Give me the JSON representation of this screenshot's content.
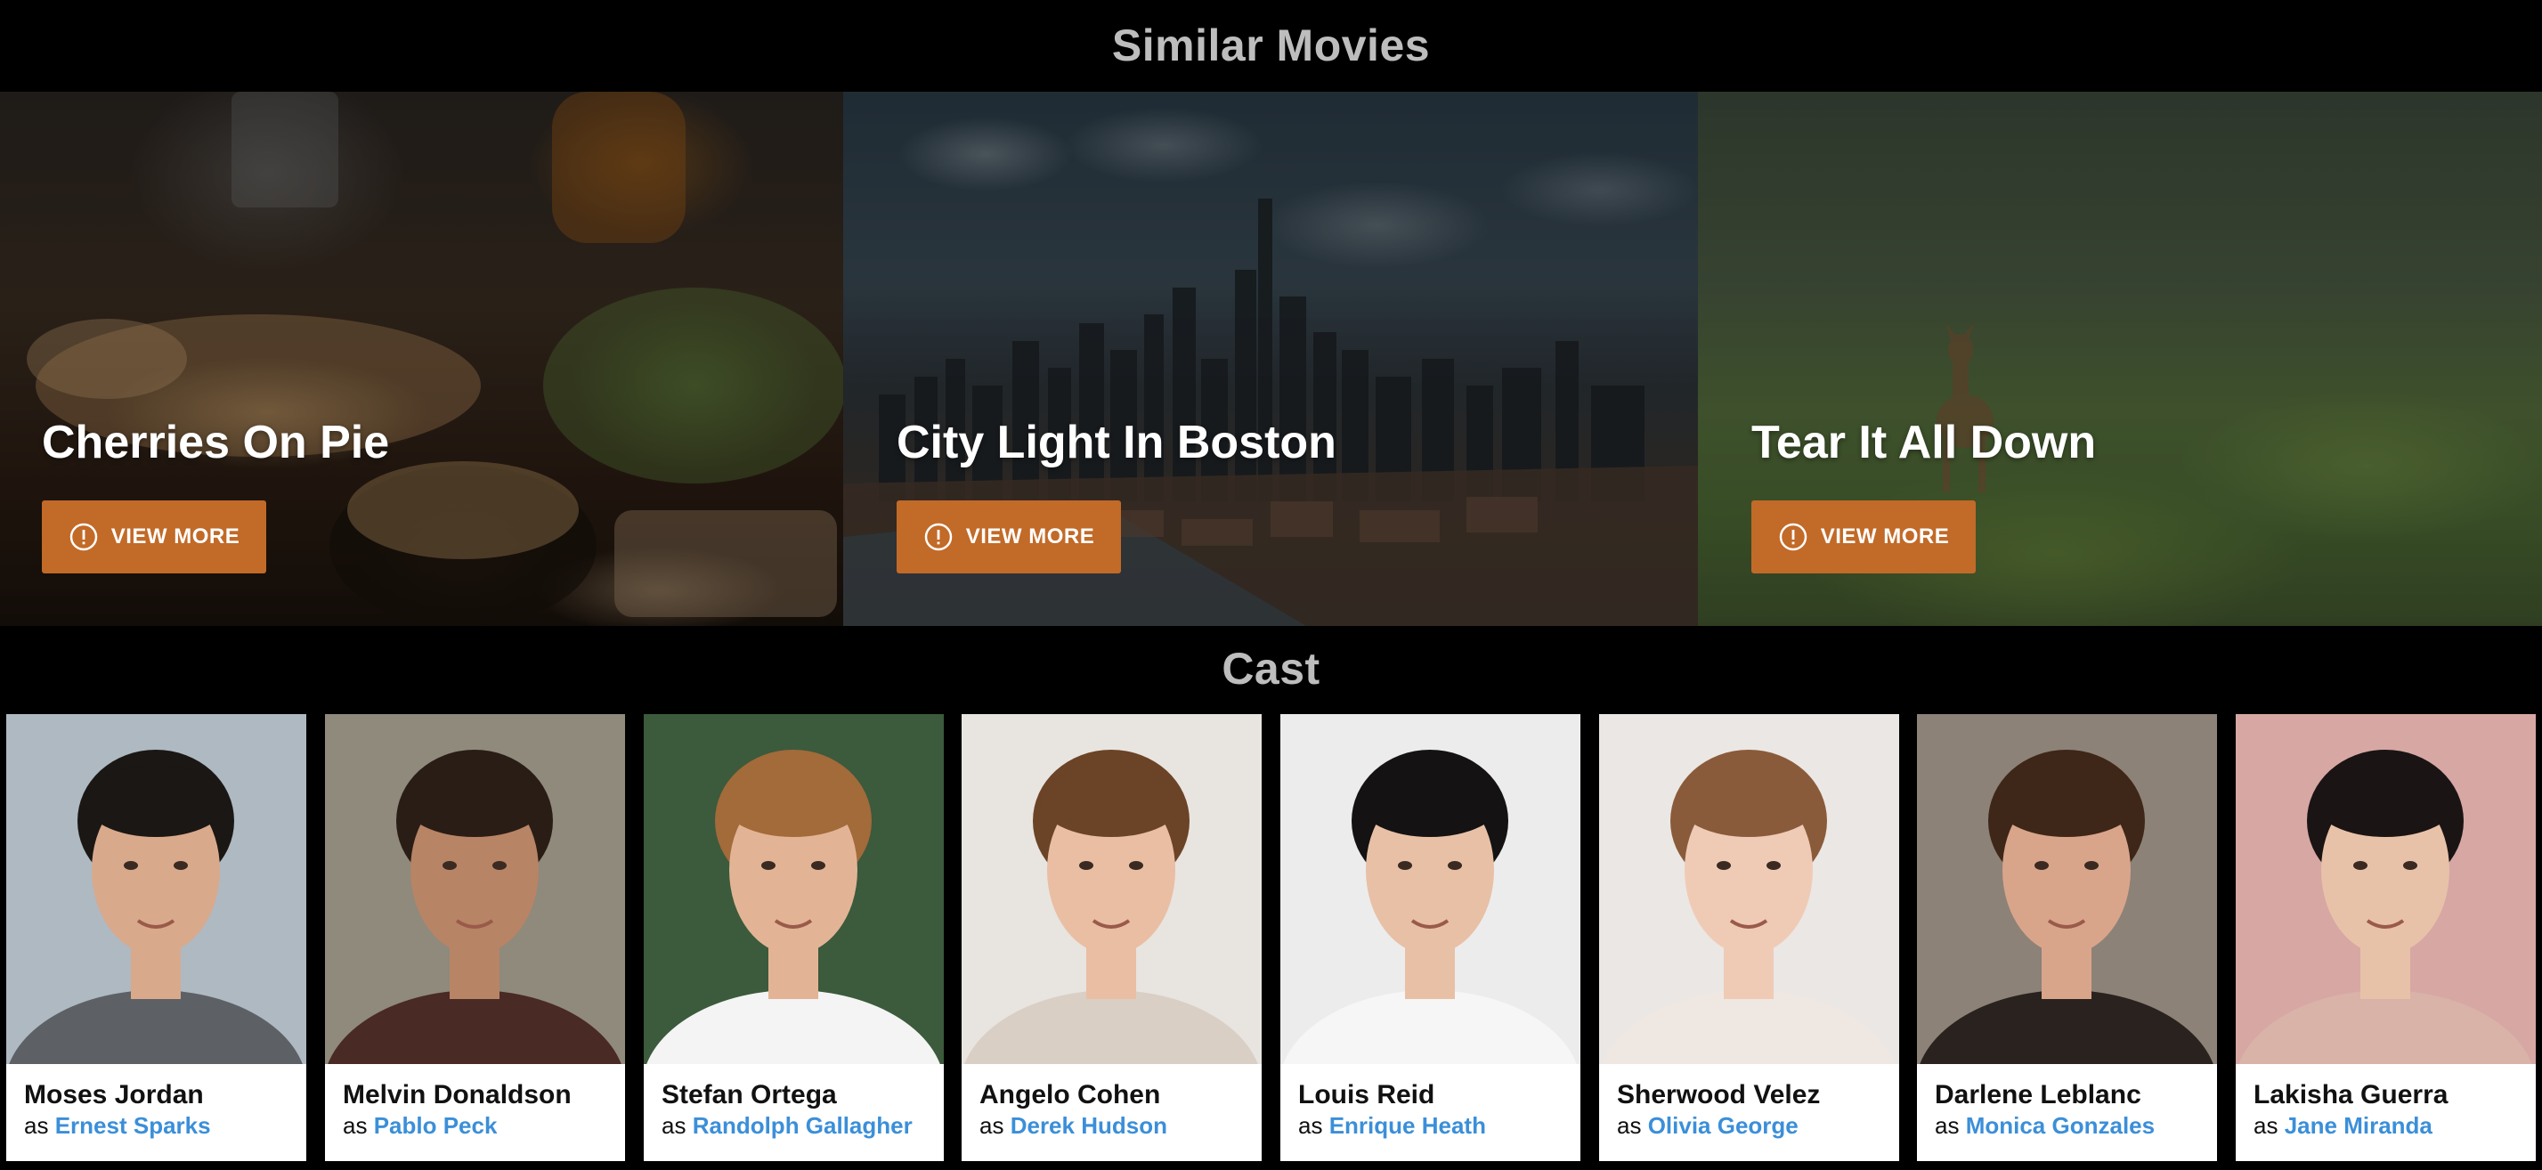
{
  "similar_movies": {
    "title": "Similar Movies",
    "slides": [
      {
        "title": "Cherries On Pie",
        "button_label": "VIEW MORE"
      },
      {
        "title": "City Light In Boston",
        "button_label": "VIEW MORE"
      },
      {
        "title": "Tear It All Down",
        "button_label": "VIEW MORE"
      }
    ],
    "pager_count": 4,
    "active_index": 0
  },
  "cast": {
    "title": "Cast",
    "role_prefix": "as",
    "members": [
      {
        "name": "Moses Jordan",
        "character": "Ernest Sparks",
        "bg": "#aeb9c2",
        "hair": "#1b1714",
        "skin": "#d9a98c",
        "shirt": "#5d6166"
      },
      {
        "name": "Melvin Donaldson",
        "character": "Pablo Peck",
        "bg": "#8f8a7c",
        "hair": "#2a1d15",
        "skin": "#b78466",
        "shirt": "#4a2a24"
      },
      {
        "name": "Stefan Ortega",
        "character": "Randolph Gallagher",
        "bg": "#3c5a3c",
        "hair": "#a36a3a",
        "skin": "#e2b495",
        "shirt": "#f4f4f4"
      },
      {
        "name": "Angelo Cohen",
        "character": "Derek Hudson",
        "bg": "#e8e4e0",
        "hair": "#6b4326",
        "skin": "#e9bea2",
        "shirt": "#d9cfc5"
      },
      {
        "name": "Louis Reid",
        "character": "Enrique Heath",
        "bg": "#ececec",
        "hair": "#141212",
        "skin": "#e8c0a6",
        "shirt": "#f6f6f6"
      },
      {
        "name": "Sherwood Velez",
        "character": "Olivia George",
        "bg": "#ebe7e4",
        "hair": "#8a5b3a",
        "skin": "#efcbb6",
        "shirt": "#efe7e2"
      },
      {
        "name": "Darlene Leblanc",
        "character": "Monica Gonzales",
        "bg": "#8c8278",
        "hair": "#3e2718",
        "skin": "#d9a58a",
        "shirt": "#2a221e"
      },
      {
        "name": "Lakisha Guerra",
        "character": "Jane Miranda",
        "bg": "#d7a7a4",
        "hair": "#1a1514",
        "skin": "#e8c2a8",
        "shirt": "#d9b2a8"
      }
    ]
  },
  "colors": {
    "accent": "#c26a28",
    "link": "#3b8fd9",
    "background": "#000000",
    "section_title": "#bdbdbd"
  },
  "icons": {
    "view_more": "info-circle-icon"
  }
}
